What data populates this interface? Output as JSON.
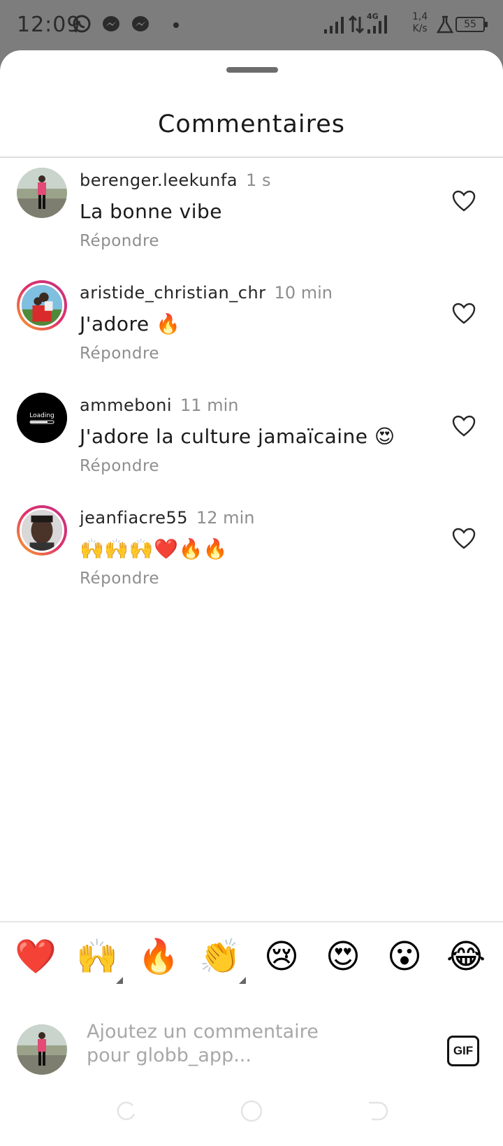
{
  "status_bar": {
    "time": "12:09",
    "icons": [
      "whatsapp-icon",
      "messenger-icon",
      "messenger-icon",
      "dot-icon",
      "signal-icon",
      "data-arrows-icon",
      "signal-4g-icon",
      "lab-icon"
    ],
    "network_label": "4G",
    "speed_value": "1,4",
    "speed_unit": "K/s",
    "battery": "55"
  },
  "sheet": {
    "title": "Commentaires"
  },
  "comments": [
    {
      "username": "berenger.leekunfa",
      "time": "1 s",
      "text": "La bonne vibe",
      "reply": "Répondre",
      "avatar_ring": false
    },
    {
      "username": "aristide_christian_chr",
      "time": "10 min",
      "text": "J'adore 🔥",
      "reply": "Répondre",
      "avatar_ring": true
    },
    {
      "username": "ammeboni",
      "time": "11 min",
      "text": "J'adore la culture jamaïcaine 😍",
      "reply": "Répondre",
      "avatar_ring": false,
      "avatar_text": "Loading"
    },
    {
      "username": "jeanfiacre55",
      "time": "12 min",
      "text": "🙌🙌🙌❤️🔥🔥",
      "reply": "Répondre",
      "avatar_ring": true
    }
  ],
  "emoji_bar": [
    "❤️",
    "🙌",
    "🔥",
    "👏",
    "😢",
    "😍",
    "😮",
    "😂"
  ],
  "composer": {
    "placeholder": "Ajoutez un commentaire pour globb_app...",
    "gif_label": "GIF"
  },
  "colors": {
    "overlay": "#7d7d7d",
    "sheet": "#ffffff",
    "muted_text": "#8e8e8e",
    "ring_gradient": [
      "#f9a825",
      "#e1306c",
      "#c13584"
    ]
  }
}
